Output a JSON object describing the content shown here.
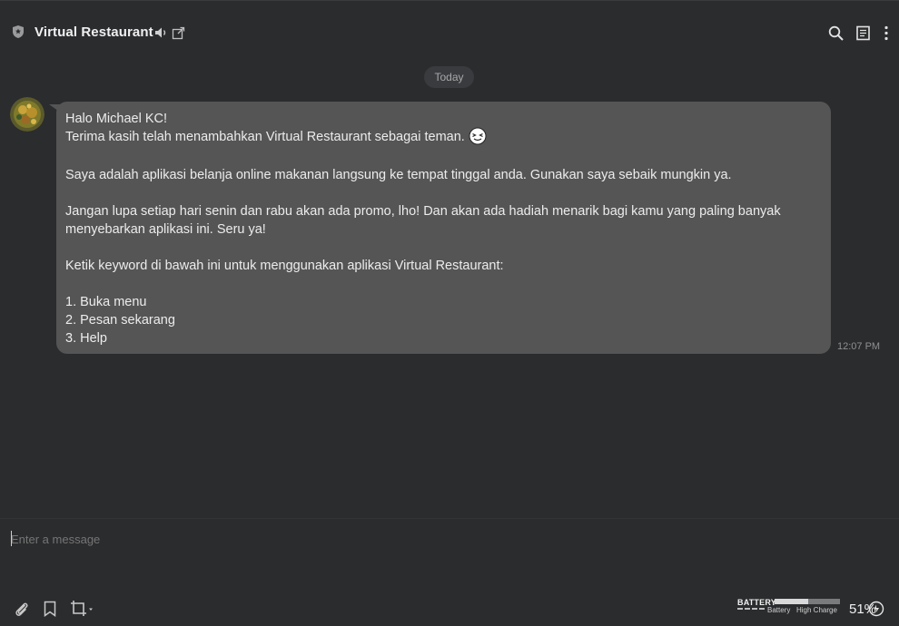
{
  "header": {
    "title": "Virtual Restaurant",
    "icons": [
      "shield-icon",
      "speaker-icon",
      "popout-icon",
      "search-icon",
      "note-icon",
      "more-icon"
    ]
  },
  "conversation": {
    "date_divider": "Today",
    "message": {
      "lines": [
        "Halo Michael KC!",
        "Terima kasih telah menambahkan Virtual Restaurant sebagai teman.",
        "Saya adalah aplikasi belanja online makanan langsung ke tempat tinggal anda. Gunakan saya sebaik mungkin ya.",
        "Jangan lupa setiap hari senin dan rabu akan ada promo, lho! Dan akan ada hadiah menarik bagi kamu yang paling banyak",
        "menyebarkan aplikasi ini. Seru ya!",
        "Ketik keyword di bawah ini untuk menggunakan aplikasi Virtual Restaurant:",
        "1. Buka menu",
        "2. Pesan sekarang",
        "3. Help"
      ],
      "time": "12:07 PM"
    }
  },
  "composer": {
    "placeholder": "Enter a message",
    "tools": [
      "paperclip-icon",
      "bookmark-icon",
      "crop-icon"
    ]
  },
  "battery_widget": {
    "title": "BATTERY",
    "sub_label": "Battery",
    "status": "High Charge",
    "percent_text": "51%",
    "level": 0.51
  },
  "colors": {
    "background": "#2b2c2e",
    "bubble": "#555555",
    "pill": "#3a3b3e"
  }
}
